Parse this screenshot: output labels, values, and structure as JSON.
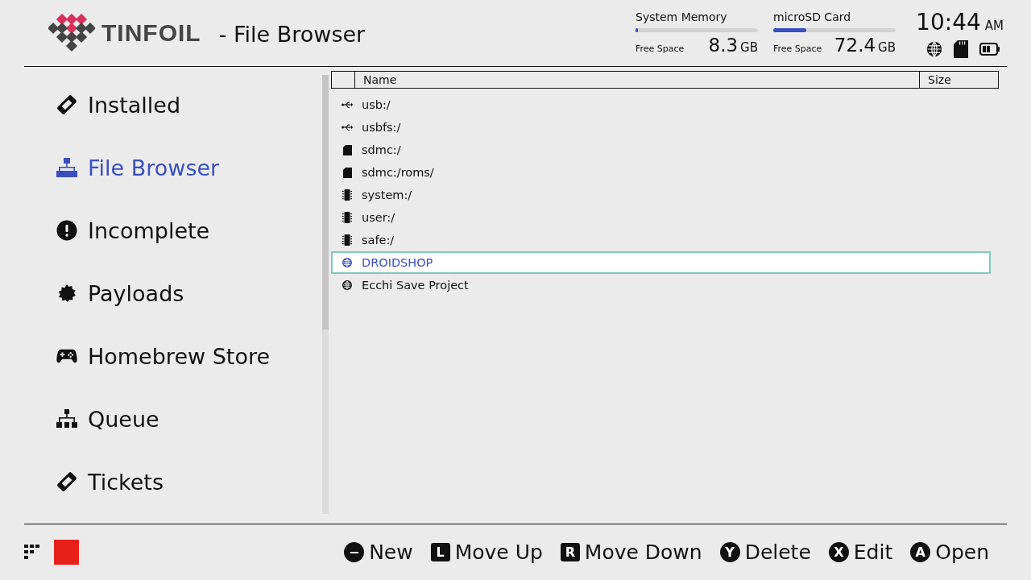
{
  "header": {
    "logo": "TINFOIL",
    "title": "- File Browser",
    "storage": [
      {
        "name": "System Memory",
        "level": 0.01,
        "free_label": "Free Space",
        "value": "8.3",
        "unit": "GB"
      },
      {
        "name": "microSD Card",
        "level": 0.27,
        "free_label": "Free Space",
        "value": "72.4",
        "unit": "GB"
      }
    ],
    "time": "10:44",
    "ampm": "AM"
  },
  "sidebar": {
    "items": [
      {
        "label": "Installed",
        "selected": false
      },
      {
        "label": "File Browser",
        "selected": true
      },
      {
        "label": "Incomplete",
        "selected": false
      },
      {
        "label": "Payloads",
        "selected": false
      },
      {
        "label": "Homebrew Store",
        "selected": false
      },
      {
        "label": "Queue",
        "selected": false
      },
      {
        "label": "Tickets",
        "selected": false
      }
    ]
  },
  "table": {
    "columns": [
      "Name",
      "Size"
    ],
    "rows": [
      {
        "kind": "usb",
        "name": "usb:/",
        "selected": false
      },
      {
        "kind": "usb",
        "name": "usbfs:/",
        "selected": false
      },
      {
        "kind": "sdcard",
        "name": "sdmc:/",
        "selected": false
      },
      {
        "kind": "sdcard",
        "name": "sdmc:/roms/",
        "selected": false
      },
      {
        "kind": "chip",
        "name": "system:/",
        "selected": false
      },
      {
        "kind": "chip",
        "name": "user:/",
        "selected": false
      },
      {
        "kind": "chip",
        "name": "safe:/",
        "selected": false
      },
      {
        "kind": "globe",
        "name": "DROIDSHOP",
        "selected": true
      },
      {
        "kind": "globe",
        "name": "Ecchi Save Project",
        "selected": false
      }
    ]
  },
  "footer": {
    "buttons": [
      {
        "kind": "round",
        "key": "−",
        "label": "New"
      },
      {
        "kind": "bumper",
        "key": "L",
        "label": "Move Up"
      },
      {
        "kind": "bumper",
        "key": "R",
        "label": "Move Down"
      },
      {
        "kind": "round",
        "key": "Y",
        "label": "Delete"
      },
      {
        "kind": "round",
        "key": "X",
        "label": "Edit"
      },
      {
        "kind": "round",
        "key": "A",
        "label": "Open"
      }
    ]
  }
}
